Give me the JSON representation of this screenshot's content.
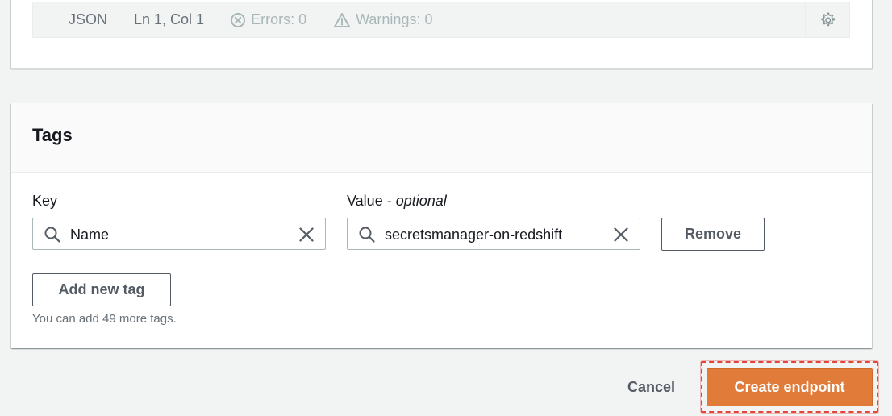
{
  "editor_status": {
    "mode": "JSON",
    "position": "Ln 1, Col 1",
    "errors": "Errors: 0",
    "warnings": "Warnings: 0",
    "icons": [
      "error-circle-icon",
      "warning-triangle-icon",
      "gear-icon"
    ]
  },
  "tags": {
    "title": "Tags",
    "key_label": "Key",
    "value_label_main": "Value - ",
    "value_label_optional": "optional",
    "rows": [
      {
        "key": "Name",
        "value": "secretsmanager-on-redshift",
        "remove_label": "Remove"
      }
    ],
    "add_label": "Add new tag",
    "hint": "You can add 49 more tags."
  },
  "actions": {
    "cancel_label": "Cancel",
    "create_label": "Create endpoint",
    "create_color": "#e07b39",
    "highlight_color": "#e2453b"
  }
}
